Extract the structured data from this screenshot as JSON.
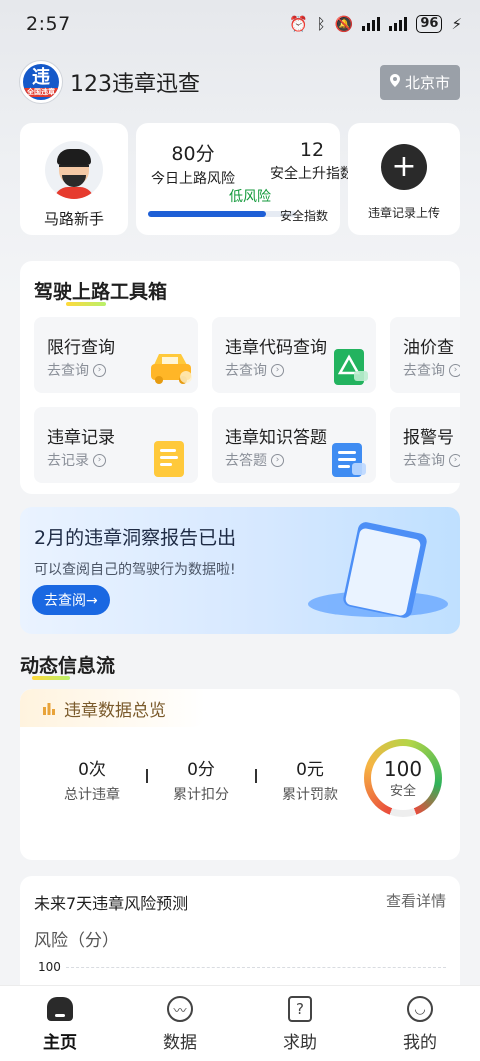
{
  "status_bar": {
    "time": "2:57",
    "battery": "96"
  },
  "header": {
    "app_name": "123违章迅查",
    "logo_char": "违",
    "logo_sub": "全国违章",
    "city": "北京市"
  },
  "profile": {
    "name": "马路新手"
  },
  "score": {
    "risk_value": "80分",
    "risk_label": "今日上路风险",
    "safety_value": "12",
    "safety_label": "安全上升指数",
    "risk_level": "低风险",
    "safety_index_label": "安全指数",
    "progress_fraction": 0.8
  },
  "upload": {
    "label": "违章记录上传"
  },
  "toolbox": {
    "title": "驾驶上路工具箱",
    "items": [
      {
        "title": "限行查询",
        "sub": "去查询"
      },
      {
        "title": "违章代码查询",
        "sub": "去查询"
      },
      {
        "title": "油价查",
        "sub": "去查询"
      },
      {
        "title": "违章记录",
        "sub": "去记录"
      },
      {
        "title": "违章知识答题",
        "sub": "去答题"
      },
      {
        "title": "报警号",
        "sub": "去查询"
      }
    ]
  },
  "banner": {
    "title": "2月的违章洞察报告已出",
    "subtitle": "可以查阅自己的驾驶行为数据啦!",
    "button": "去查阅→"
  },
  "feed": {
    "title": "动态信息流"
  },
  "overview": {
    "tag": "违章数据总览",
    "stats": [
      {
        "value": "0次",
        "label": "总计违章"
      },
      {
        "value": "0分",
        "label": "累计扣分"
      },
      {
        "value": "0元",
        "label": "累计罚款"
      }
    ],
    "gauge_value": "100",
    "gauge_label": "安全"
  },
  "forecast": {
    "title": "未来7天违章风险预测",
    "link": "查看详情",
    "unit": "风险（分）",
    "tick": "100"
  },
  "tabbar": [
    {
      "label": "主页",
      "icon": "home-icon"
    },
    {
      "label": "数据",
      "icon": "chart-icon"
    },
    {
      "label": "求助",
      "icon": "help-icon"
    },
    {
      "label": "我的",
      "icon": "profile-icon"
    }
  ],
  "colors": {
    "accent": "#1e5fd6",
    "risk_low": "#149a3c",
    "button": "#1a68e2"
  }
}
